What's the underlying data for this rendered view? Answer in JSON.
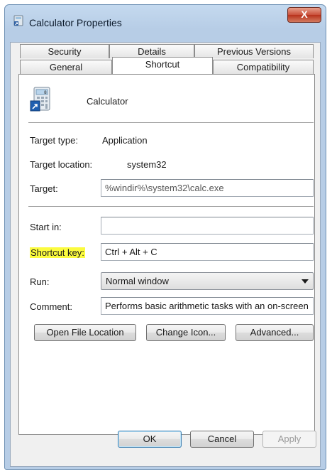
{
  "window": {
    "title": "Calculator Properties",
    "close_glyph": "X"
  },
  "tabs_top": [
    {
      "label": "Security"
    },
    {
      "label": "Details"
    },
    {
      "label": "Previous Versions"
    }
  ],
  "tabs_bottom": [
    {
      "label": "General"
    },
    {
      "label": "Shortcut",
      "active": true
    },
    {
      "label": "Compatibility"
    }
  ],
  "shortcut": {
    "app_name": "Calculator",
    "target_type_label": "Target type:",
    "target_type_value": "Application",
    "target_location_label": "Target location:",
    "target_location_value": "system32",
    "target_label": "Target:",
    "target_value": "%windir%\\system32\\calc.exe",
    "start_in_label": "Start in:",
    "start_in_value": "",
    "shortcut_key_label": "Shortcut key:",
    "shortcut_key_value": "Ctrl + Alt + C",
    "run_label": "Run:",
    "run_value": "Normal window",
    "comment_label": "Comment:",
    "comment_value": "Performs basic arithmetic tasks with an on-screen",
    "open_file_location": "Open File Location",
    "change_icon": "Change Icon...",
    "advanced": "Advanced..."
  },
  "footer": {
    "ok": "OK",
    "cancel": "Cancel",
    "apply": "Apply"
  },
  "colors": {
    "highlight": "#fbfb3f",
    "title_bar": "#b7cde6",
    "close_button": "#c9503b"
  },
  "icons": {
    "title": "calculator-shortcut-icon",
    "app": "calculator-icon",
    "dropdown": "chevron-down-icon"
  }
}
